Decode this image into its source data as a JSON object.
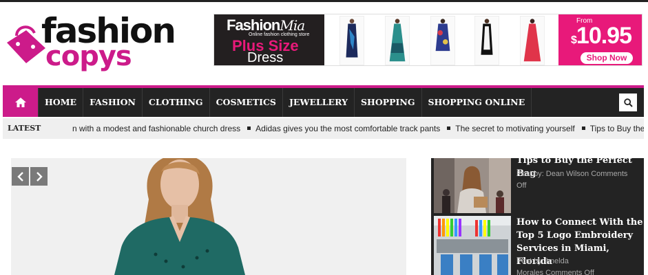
{
  "logo": {
    "line1": "fashion",
    "line2": "copys",
    "brand_color": "#cc1b8a"
  },
  "banner_ad": {
    "brand": "Fashion",
    "brand_script": "Mia",
    "tagline": "Online fashion clothing store",
    "headline": "Plus Size",
    "subheadline": "Dress",
    "from_label": "From",
    "currency": "$",
    "price": "10.95",
    "cta": "Shop Now"
  },
  "nav": {
    "accent": "#cc1b8a",
    "home_icon": "home-icon",
    "search_icon": "search-icon",
    "items": [
      {
        "label": "HOME"
      },
      {
        "label": "FASHION"
      },
      {
        "label": "CLOTHING"
      },
      {
        "label": "COSMETICS"
      },
      {
        "label": "JEWELLERY"
      },
      {
        "label": "SHOPPING"
      },
      {
        "label": "SHOPPING ONLINE"
      }
    ]
  },
  "ticker": {
    "label": "LATEST UPDATE",
    "items": [
      "n with a modest and fashionable church dress",
      "Adidas gives you the most comfortable track pants",
      "The secret to motivating yourself",
      "Tips to Buy the Perfect Bag"
    ]
  },
  "slider": {
    "prev_icon": "chevron-left-icon",
    "next_icon": "chevron-right-icon"
  },
  "sidebar": {
    "posts": [
      {
        "title": "Tips to Buy the Perfect Bag",
        "meta_line1": "Post by: Dean Wilson  Comments",
        "meta_line2": "Off"
      },
      {
        "title": "How to Connect With the Top 5 Logo Embroidery Services in Miami, Florida",
        "meta_line1": "Post by: Imelda",
        "meta_line2": "Morales  Comments Off"
      }
    ]
  }
}
